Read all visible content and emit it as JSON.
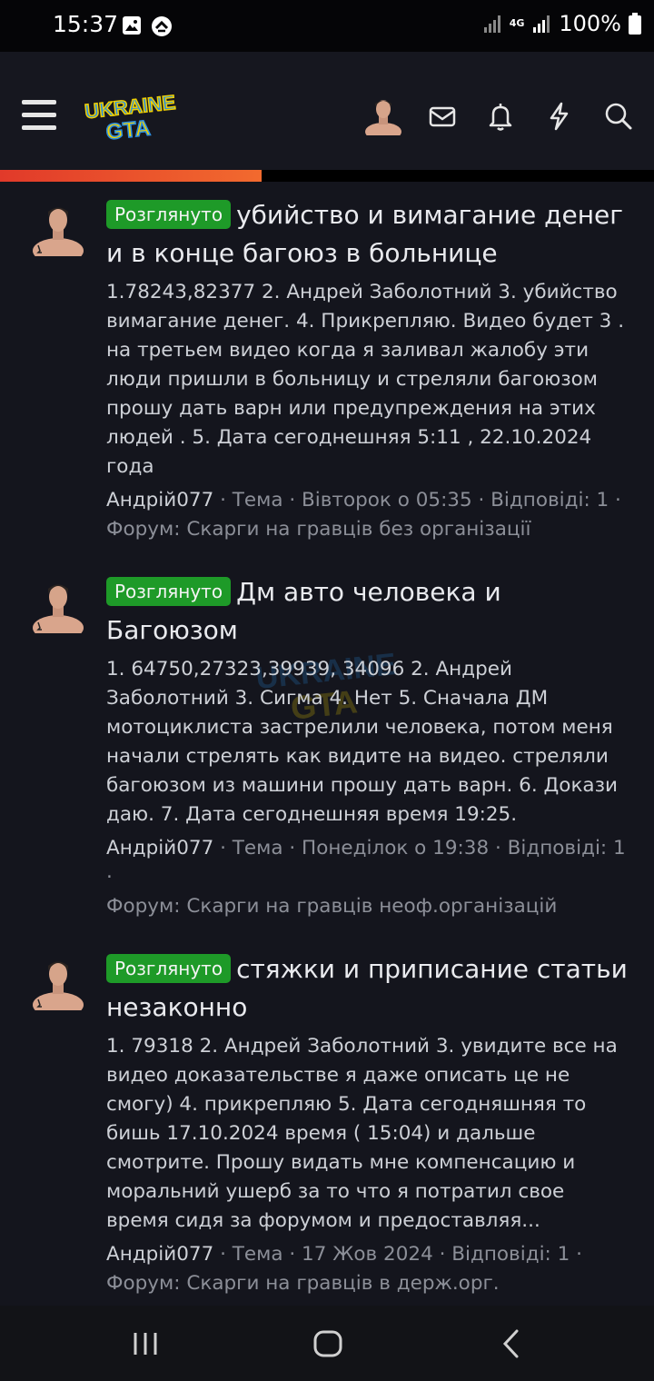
{
  "status_bar": {
    "time": "15:37",
    "network": "4G",
    "battery_percent": "100%",
    "icons": [
      "image-icon",
      "speed-icon",
      "signal-icon",
      "battery-icon"
    ]
  },
  "header": {
    "logo_text_line1": "UKRAINE",
    "logo_text_line2": "GTA",
    "icons": [
      "menu-icon",
      "avatar",
      "mail-icon",
      "bell-icon",
      "lightning-icon",
      "search-icon"
    ],
    "scroll_progress": 0.4
  },
  "threads": [
    {
      "badge": "Розглянуто",
      "title": "убийство и вимагание денег и в конце багоюз в больнице",
      "snippet": "1.78243,82377 2. Андрей Заболотний 3. убийство вимагание денег. 4. Прикрепляю. Видео будет 3 . на третьем видео когда я заливал жалобу эти люди пришли в больницу и стреляли багоюзом прошу дать варн или предупреждения на этих людей . 5. Дата сегоднешняя 5:11 , 22.10.2024 года",
      "author": "Андрій077",
      "meta_rest": " · Тема · Вівторок о 05:35 · Відповіді: 1 · ",
      "forum": "Форум: Скарги на гравців без організації"
    },
    {
      "badge": "Розглянуто",
      "title": "Дм авто человека и Багоюзом",
      "snippet": "1. 64750,27323,39939, 34096 2. Андрей Заболотний 3. Сигма 4. Нет 5. Сначала ДМ мотоциклиста застрелили человека, потом меня начали стрелять как видите на видео. стреляли багоюзом из машини прошу дать варн. 6. Докази даю. 7. Дата сегоднешняя время 19:25.",
      "author": "Андрій077",
      "meta_rest": " · Тема · Понеділок о 19:38 · Відповіді: 1 · ",
      "forum": "Форум: Скарги на гравців неоф.організацій"
    },
    {
      "badge": "Розглянуто",
      "title": "стяжки и приписание статьи незаконно",
      "snippet": "1. 79318 2. Андрей Заболотний 3. увидите все на видео доказательстве я даже описать це не смогу) 4. прикрепляю 5. Дата сегодняшняя то бишь 17.10.2024 время ( 15:04) и дальше смотрите. Прошу видать мне компенсацию и моральний ушерб за то что я потратил свое время сидя за форумом и предоставляя...",
      "author": "Андрій077",
      "meta_rest": " · Тема · 17 Жов 2024 · Відповіді: 1 · ",
      "forum": "Форум: Скарги на гравців в держ.орг."
    }
  ],
  "nav_bar": {
    "icons": [
      "recent-apps-icon",
      "home-icon",
      "back-icon"
    ]
  },
  "colors": {
    "badge": "#1e9a28",
    "accent": "#e13a2a",
    "background": "#14151d"
  }
}
